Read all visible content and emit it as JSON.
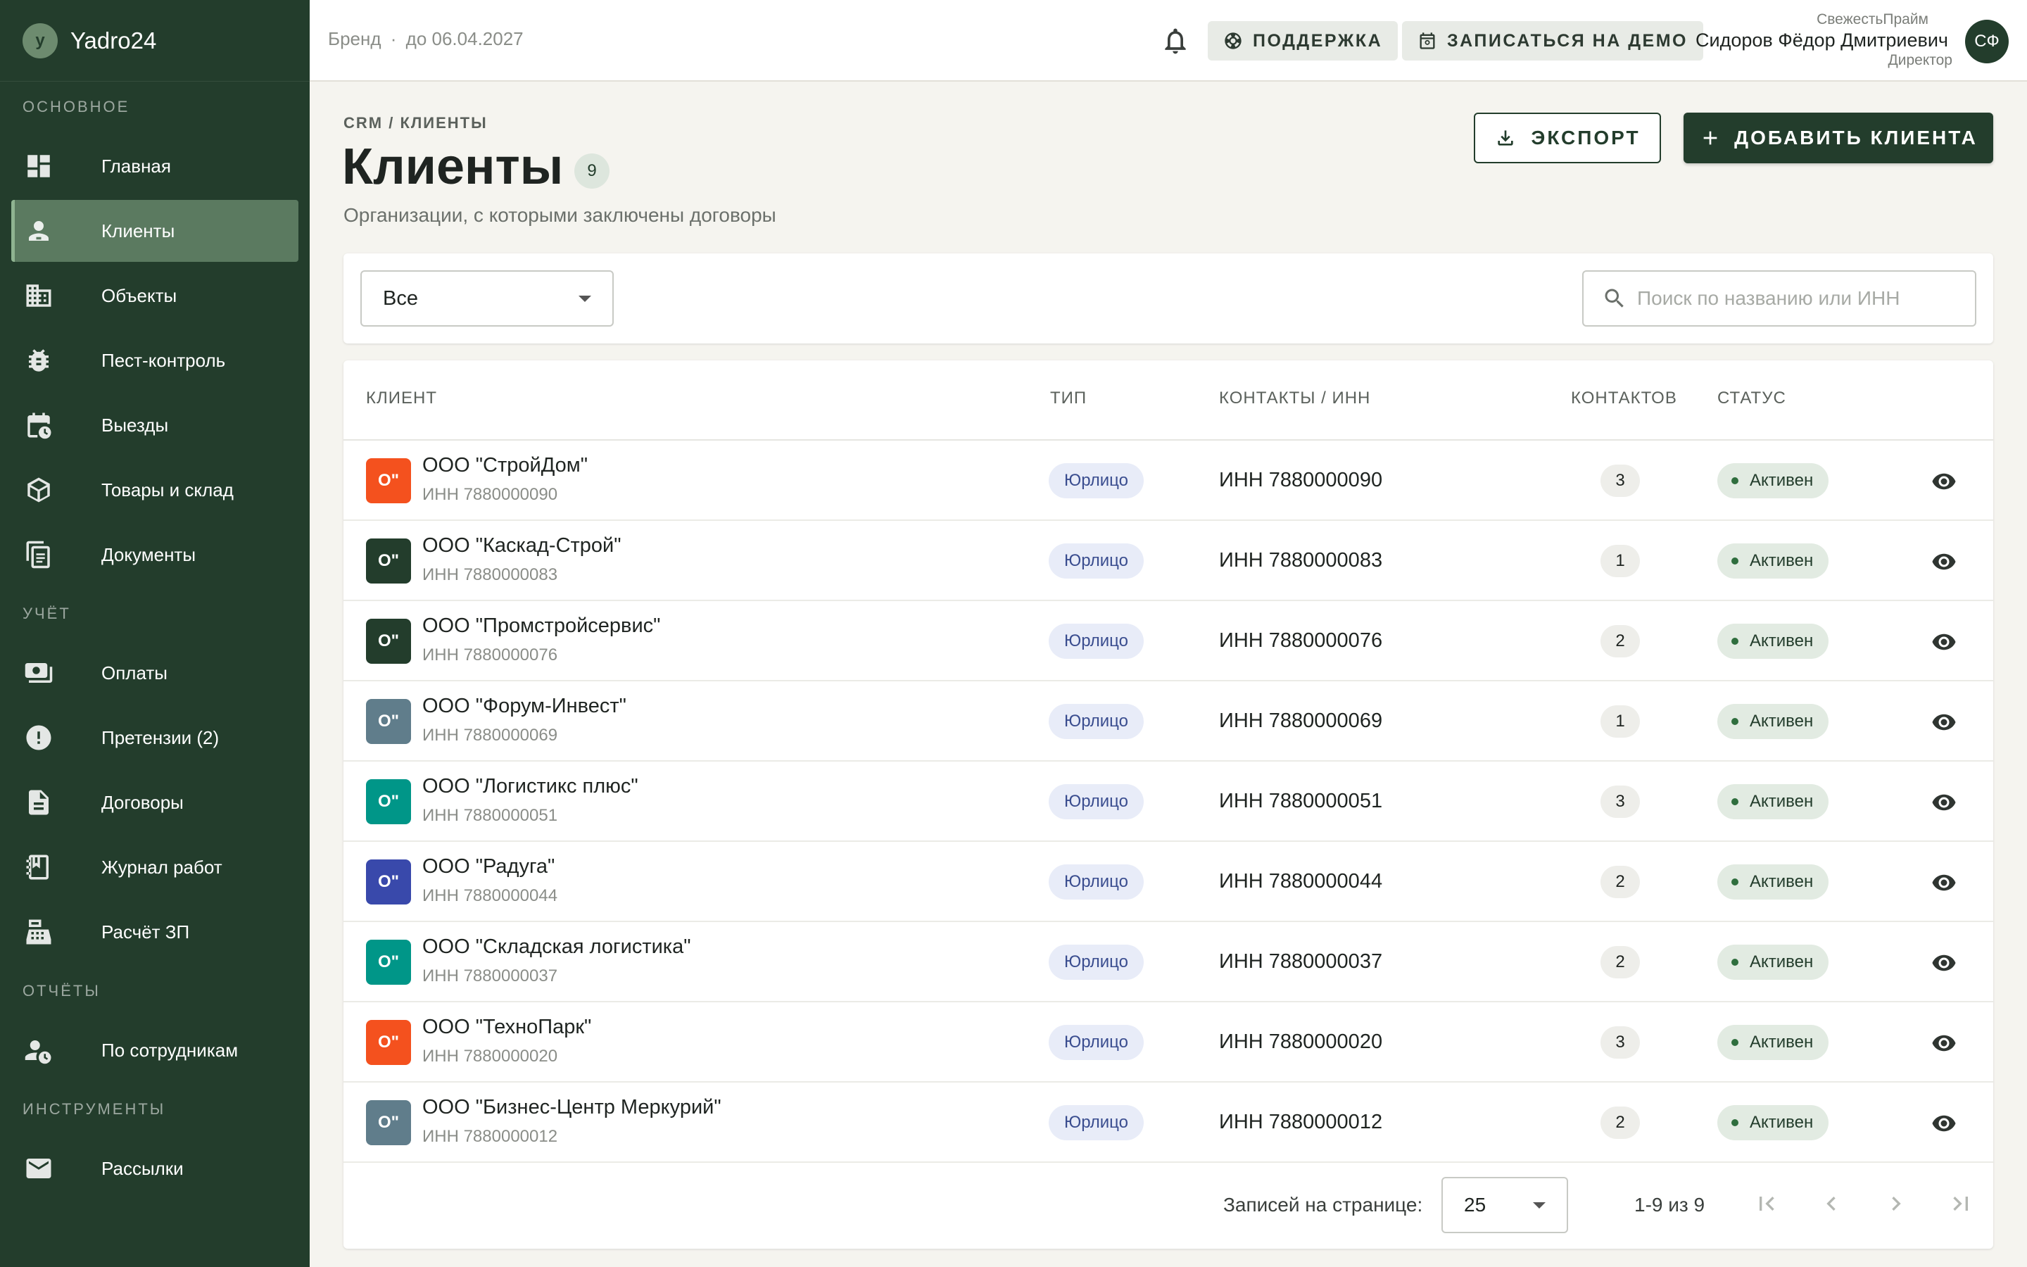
{
  "app": {
    "name": "Yadro24",
    "logo_letter": "y"
  },
  "sidebar": {
    "sections": [
      {
        "title": "ОСНОВНОЕ"
      },
      {
        "title": "УЧЁТ"
      },
      {
        "title": "ОТЧЁТЫ"
      },
      {
        "title": "ИНСТРУМЕНТЫ"
      }
    ],
    "items": [
      {
        "label": "Главная",
        "icon": "dashboard-icon"
      },
      {
        "label": "Клиенты",
        "icon": "clients-icon",
        "active": true
      },
      {
        "label": "Объекты",
        "icon": "building-icon"
      },
      {
        "label": "Пест-контроль",
        "icon": "bug-icon"
      },
      {
        "label": "Выезды",
        "icon": "calendar-clock-icon"
      },
      {
        "label": "Товары и склад",
        "icon": "package-icon"
      },
      {
        "label": "Документы",
        "icon": "documents-icon"
      },
      {
        "label": "Оплаты",
        "icon": "payments-icon"
      },
      {
        "label": "Претензии (2)",
        "icon": "alert-circle-icon"
      },
      {
        "label": "Договоры",
        "icon": "contract-icon"
      },
      {
        "label": "Журнал работ",
        "icon": "journal-icon"
      },
      {
        "label": "Расчёт ЗП",
        "icon": "cash-register-icon"
      },
      {
        "label": "По сотрудникам",
        "icon": "employee-clock-icon"
      },
      {
        "label": "Рассылки",
        "icon": "mail-icon"
      }
    ]
  },
  "topbar": {
    "plan_label": "Бренд",
    "plan_separator": "·",
    "plan_until": "до 06.04.2027",
    "support_label": "ПОДДЕРЖКА",
    "demo_label": "ЗАПИСАТЬСЯ НА ДЕМО",
    "user": {
      "org": "СвежестьПрайм",
      "name": "Сидоров Фёдор Дмитриевич",
      "role": "Директор",
      "initials": "СФ"
    }
  },
  "page": {
    "breadcrumb": "CRM / КЛИЕНТЫ",
    "title": "Клиенты",
    "count": "9",
    "subtitle": "Организации, с которыми заключены договоры",
    "export_label": "ЭКСПОРТ",
    "add_label": "ДОБАВИТЬ КЛИЕНТА"
  },
  "filters": {
    "type_selected": "Все",
    "search_placeholder": "Поиск по названию или ИНН"
  },
  "table": {
    "columns": [
      "КЛИЕНТ",
      "ТИП",
      "КОНТАКТЫ / ИНН",
      "КОНТАКТОВ",
      "СТАТУС"
    ],
    "rows": [
      {
        "avatar": "О\"",
        "color": "#f4511e",
        "name": "ООО \"СтройДом\"",
        "inn_sub": "ИНН 7880000090",
        "type": "Юрлицо",
        "inn": "ИНН 7880000090",
        "contacts": "3",
        "status": "Активен"
      },
      {
        "avatar": "О\"",
        "color": "#233d2c",
        "name": "ООО \"Каскад-Строй\"",
        "inn_sub": "ИНН 7880000083",
        "type": "Юрлицо",
        "inn": "ИНН 7880000083",
        "contacts": "1",
        "status": "Активен"
      },
      {
        "avatar": "О\"",
        "color": "#233d2c",
        "name": "ООО \"Промстройсервис\"",
        "inn_sub": "ИНН 7880000076",
        "type": "Юрлицо",
        "inn": "ИНН 7880000076",
        "contacts": "2",
        "status": "Активен"
      },
      {
        "avatar": "О\"",
        "color": "#607d8b",
        "name": "ООО \"Форум-Инвест\"",
        "inn_sub": "ИНН 7880000069",
        "type": "Юрлицо",
        "inn": "ИНН 7880000069",
        "contacts": "1",
        "status": "Активен"
      },
      {
        "avatar": "О\"",
        "color": "#009688",
        "name": "ООО \"Логистикс плюс\"",
        "inn_sub": "ИНН 7880000051",
        "type": "Юрлицо",
        "inn": "ИНН 7880000051",
        "contacts": "3",
        "status": "Активен"
      },
      {
        "avatar": "О\"",
        "color": "#3949ab",
        "name": "ООО \"Радуга\"",
        "inn_sub": "ИНН 7880000044",
        "type": "Юрлицо",
        "inn": "ИНН 7880000044",
        "contacts": "2",
        "status": "Активен"
      },
      {
        "avatar": "О\"",
        "color": "#009688",
        "name": "ООО \"Складская логистика\"",
        "inn_sub": "ИНН 7880000037",
        "type": "Юрлицо",
        "inn": "ИНН 7880000037",
        "contacts": "2",
        "status": "Активен"
      },
      {
        "avatar": "О\"",
        "color": "#f4511e",
        "name": "ООО \"ТехноПарк\"",
        "inn_sub": "ИНН 7880000020",
        "type": "Юрлицо",
        "inn": "ИНН 7880000020",
        "contacts": "3",
        "status": "Активен"
      },
      {
        "avatar": "О\"",
        "color": "#607d8b",
        "name": "ООО \"Бизнес-Центр Меркурий\"",
        "inn_sub": "ИНН 7880000012",
        "type": "Юрлицо",
        "inn": "ИНН 7880000012",
        "contacts": "2",
        "status": "Активен"
      }
    ]
  },
  "pagination": {
    "rows_per_page_label": "Записей на странице:",
    "rows_per_page": "25",
    "range": "1-9 из 9"
  },
  "colors": {
    "sidebar_bg": "#233d2c",
    "accent": "#233d2c",
    "active_item": "#5b7a60",
    "type_chip": "#e8ecf8",
    "status_chip": "#e2ebe2"
  }
}
